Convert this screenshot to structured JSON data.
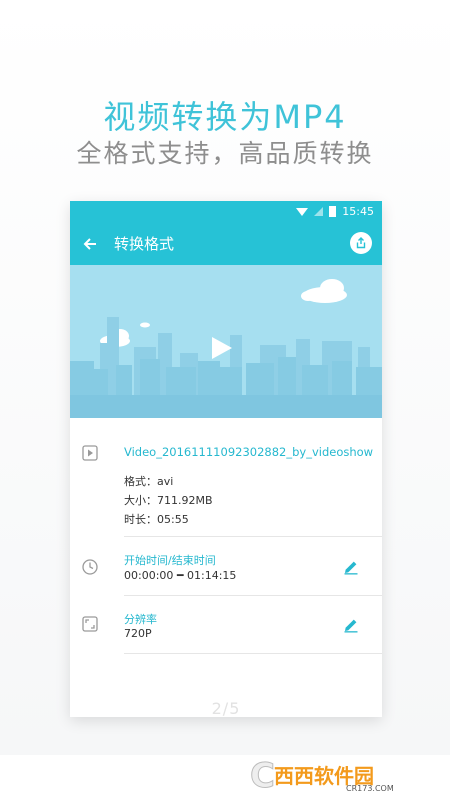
{
  "hero": {
    "title": "视频转换为MP4",
    "subtitle": "全格式支持，高品质转换"
  },
  "status_bar": {
    "time": "15:45"
  },
  "app_bar": {
    "title": "转换格式"
  },
  "file": {
    "name": "Video_20161111092302882_by_videoshow",
    "format_label": "格式：",
    "format_value": "avi",
    "size_label": "大小：",
    "size_value": "711.92MB",
    "duration_label": "时长：",
    "duration_value": "05:55"
  },
  "trim": {
    "title": "开始时间/结束时间",
    "value": "00:00:00 ━ 01:14:15"
  },
  "resolution": {
    "title": "分辨率",
    "value": "720P"
  },
  "pager": {
    "text": "2/5"
  },
  "watermark": {
    "logo_text": "西西软件园",
    "url": "CR173.COM"
  },
  "colors": {
    "accent": "#26c2d6",
    "headline": "#3fc3d8",
    "preview_sky": "#a6dff0"
  }
}
